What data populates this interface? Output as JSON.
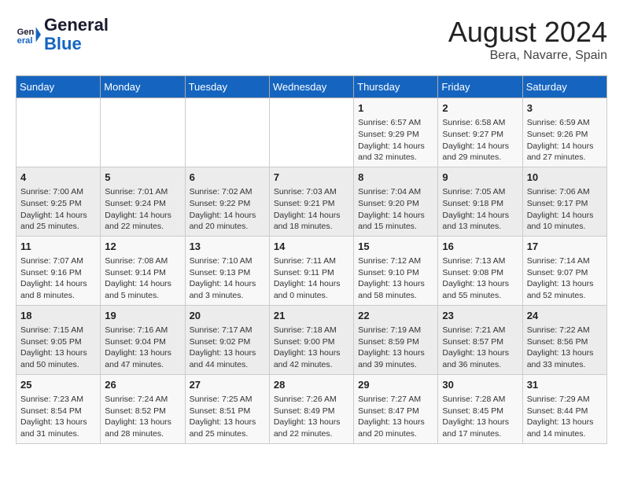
{
  "header": {
    "logo_general": "General",
    "logo_blue": "Blue",
    "month": "August 2024",
    "location": "Bera, Navarre, Spain"
  },
  "weekdays": [
    "Sunday",
    "Monday",
    "Tuesday",
    "Wednesday",
    "Thursday",
    "Friday",
    "Saturday"
  ],
  "weeks": [
    [
      {
        "day": "",
        "info": ""
      },
      {
        "day": "",
        "info": ""
      },
      {
        "day": "",
        "info": ""
      },
      {
        "day": "",
        "info": ""
      },
      {
        "day": "1",
        "info": "Sunrise: 6:57 AM\nSunset: 9:29 PM\nDaylight: 14 hours and 32 minutes."
      },
      {
        "day": "2",
        "info": "Sunrise: 6:58 AM\nSunset: 9:27 PM\nDaylight: 14 hours and 29 minutes."
      },
      {
        "day": "3",
        "info": "Sunrise: 6:59 AM\nSunset: 9:26 PM\nDaylight: 14 hours and 27 minutes."
      }
    ],
    [
      {
        "day": "4",
        "info": "Sunrise: 7:00 AM\nSunset: 9:25 PM\nDaylight: 14 hours and 25 minutes."
      },
      {
        "day": "5",
        "info": "Sunrise: 7:01 AM\nSunset: 9:24 PM\nDaylight: 14 hours and 22 minutes."
      },
      {
        "day": "6",
        "info": "Sunrise: 7:02 AM\nSunset: 9:22 PM\nDaylight: 14 hours and 20 minutes."
      },
      {
        "day": "7",
        "info": "Sunrise: 7:03 AM\nSunset: 9:21 PM\nDaylight: 14 hours and 18 minutes."
      },
      {
        "day": "8",
        "info": "Sunrise: 7:04 AM\nSunset: 9:20 PM\nDaylight: 14 hours and 15 minutes."
      },
      {
        "day": "9",
        "info": "Sunrise: 7:05 AM\nSunset: 9:18 PM\nDaylight: 14 hours and 13 minutes."
      },
      {
        "day": "10",
        "info": "Sunrise: 7:06 AM\nSunset: 9:17 PM\nDaylight: 14 hours and 10 minutes."
      }
    ],
    [
      {
        "day": "11",
        "info": "Sunrise: 7:07 AM\nSunset: 9:16 PM\nDaylight: 14 hours and 8 minutes."
      },
      {
        "day": "12",
        "info": "Sunrise: 7:08 AM\nSunset: 9:14 PM\nDaylight: 14 hours and 5 minutes."
      },
      {
        "day": "13",
        "info": "Sunrise: 7:10 AM\nSunset: 9:13 PM\nDaylight: 14 hours and 3 minutes."
      },
      {
        "day": "14",
        "info": "Sunrise: 7:11 AM\nSunset: 9:11 PM\nDaylight: 14 hours and 0 minutes."
      },
      {
        "day": "15",
        "info": "Sunrise: 7:12 AM\nSunset: 9:10 PM\nDaylight: 13 hours and 58 minutes."
      },
      {
        "day": "16",
        "info": "Sunrise: 7:13 AM\nSunset: 9:08 PM\nDaylight: 13 hours and 55 minutes."
      },
      {
        "day": "17",
        "info": "Sunrise: 7:14 AM\nSunset: 9:07 PM\nDaylight: 13 hours and 52 minutes."
      }
    ],
    [
      {
        "day": "18",
        "info": "Sunrise: 7:15 AM\nSunset: 9:05 PM\nDaylight: 13 hours and 50 minutes."
      },
      {
        "day": "19",
        "info": "Sunrise: 7:16 AM\nSunset: 9:04 PM\nDaylight: 13 hours and 47 minutes."
      },
      {
        "day": "20",
        "info": "Sunrise: 7:17 AM\nSunset: 9:02 PM\nDaylight: 13 hours and 44 minutes."
      },
      {
        "day": "21",
        "info": "Sunrise: 7:18 AM\nSunset: 9:00 PM\nDaylight: 13 hours and 42 minutes."
      },
      {
        "day": "22",
        "info": "Sunrise: 7:19 AM\nSunset: 8:59 PM\nDaylight: 13 hours and 39 minutes."
      },
      {
        "day": "23",
        "info": "Sunrise: 7:21 AM\nSunset: 8:57 PM\nDaylight: 13 hours and 36 minutes."
      },
      {
        "day": "24",
        "info": "Sunrise: 7:22 AM\nSunset: 8:56 PM\nDaylight: 13 hours and 33 minutes."
      }
    ],
    [
      {
        "day": "25",
        "info": "Sunrise: 7:23 AM\nSunset: 8:54 PM\nDaylight: 13 hours and 31 minutes."
      },
      {
        "day": "26",
        "info": "Sunrise: 7:24 AM\nSunset: 8:52 PM\nDaylight: 13 hours and 28 minutes."
      },
      {
        "day": "27",
        "info": "Sunrise: 7:25 AM\nSunset: 8:51 PM\nDaylight: 13 hours and 25 minutes."
      },
      {
        "day": "28",
        "info": "Sunrise: 7:26 AM\nSunset: 8:49 PM\nDaylight: 13 hours and 22 minutes."
      },
      {
        "day": "29",
        "info": "Sunrise: 7:27 AM\nSunset: 8:47 PM\nDaylight: 13 hours and 20 minutes."
      },
      {
        "day": "30",
        "info": "Sunrise: 7:28 AM\nSunset: 8:45 PM\nDaylight: 13 hours and 17 minutes."
      },
      {
        "day": "31",
        "info": "Sunrise: 7:29 AM\nSunset: 8:44 PM\nDaylight: 13 hours and 14 minutes."
      }
    ]
  ]
}
